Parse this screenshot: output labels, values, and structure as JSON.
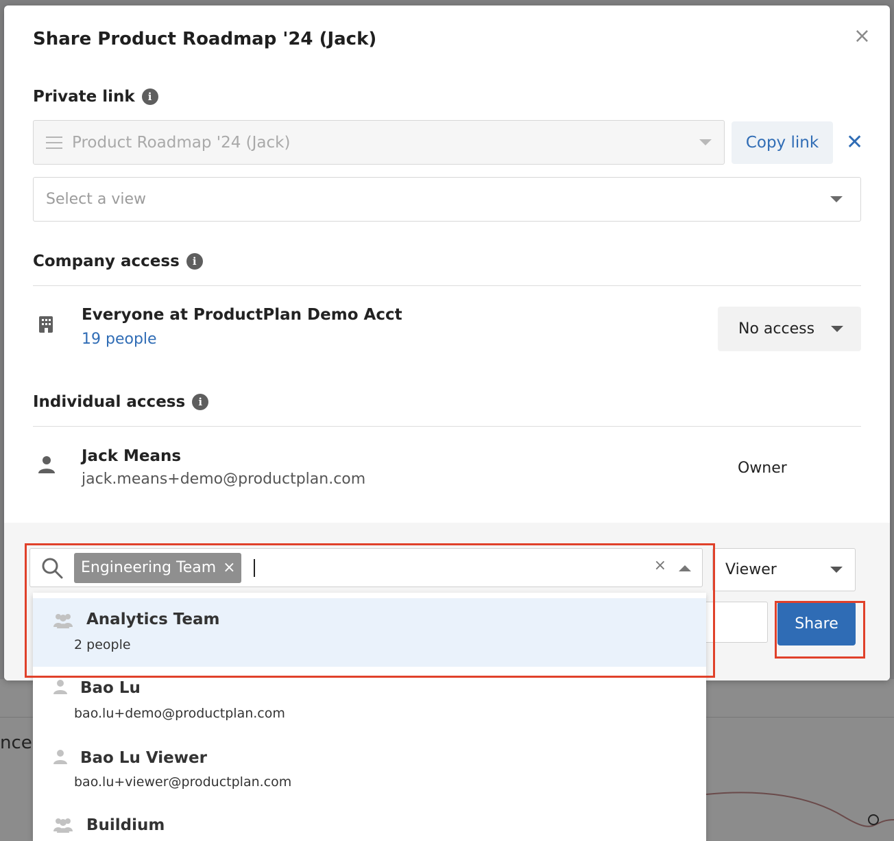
{
  "modal": {
    "title": "Share Product Roadmap '24 (Jack)",
    "close": "×"
  },
  "private_link": {
    "label": "Private link",
    "info": "i",
    "selected": "Product Roadmap '24 (Jack)",
    "copy_label": "Copy link",
    "remove": "✕",
    "view_placeholder": "Select a view"
  },
  "company_access": {
    "label": "Company access",
    "info": "i",
    "name": "Everyone at ProductPlan Demo Acct",
    "count": "19 people",
    "access": "No access"
  },
  "individual_access": {
    "label": "Individual access",
    "info": "i",
    "name": "Jack Means",
    "email": "jack.means+demo@productplan.com",
    "role": "Owner"
  },
  "invite": {
    "chip": "Engineering Team",
    "chip_remove": "×",
    "clear": "×",
    "role": "Viewer",
    "share_label": "Share"
  },
  "dropdown": {
    "items": [
      {
        "name": "Analytics Team",
        "sub": "2 people",
        "type": "team"
      },
      {
        "name": "Bao Lu",
        "sub": "bao.lu+demo@productplan.com",
        "type": "person"
      },
      {
        "name": "Bao Lu Viewer",
        "sub": "bao.lu+viewer@productplan.com",
        "type": "person"
      },
      {
        "name": "Buildium",
        "sub": "",
        "type": "team"
      }
    ]
  },
  "background": {
    "partial_text": "nce"
  },
  "colors": {
    "accent": "#2f6cb5",
    "annotation": "#e0412a",
    "chip": "#8f8f8f",
    "active_row": "#eaf2fb"
  }
}
